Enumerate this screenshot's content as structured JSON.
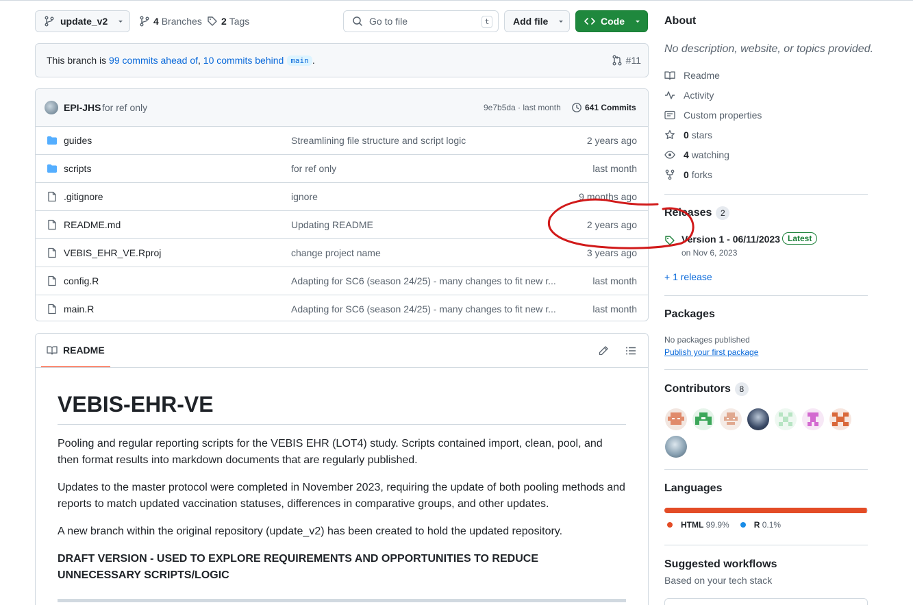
{
  "toolbar": {
    "branch_name": "update_v2",
    "branches_count": "4",
    "branches_label": "Branches",
    "tags_count": "2",
    "tags_label": "Tags",
    "goto_placeholder": "Go to file",
    "goto_shortcut": "t",
    "add_file_label": "Add file",
    "code_label": "Code"
  },
  "branch_banner": {
    "prefix": "This branch is ",
    "ahead": "99 commits ahead of",
    "separator": ", ",
    "behind": "10 commits behind",
    "base_branch": "main",
    "suffix": ".",
    "pr_number": "#11"
  },
  "latest_commit": {
    "author": "EPI-JHS",
    "message": "for ref only",
    "sha": "9e7b5da",
    "time": " · last month",
    "commits_count": "641 Commits"
  },
  "files": [
    {
      "type": "folder",
      "name": "guides",
      "message": "Streamlining file structure and script logic",
      "age": "2 years ago"
    },
    {
      "type": "folder",
      "name": "scripts",
      "message": "for ref only",
      "age": "last month"
    },
    {
      "type": "file",
      "name": ".gitignore",
      "message": "ignore",
      "age": "9 months ago"
    },
    {
      "type": "file",
      "name": "README.md",
      "message": "Updating README",
      "age": "2 years ago"
    },
    {
      "type": "file",
      "name": "VEBIS_EHR_VE.Rproj",
      "message": "change project name",
      "age": "3 years ago"
    },
    {
      "type": "file",
      "name": "config.R",
      "message": "Adapting for SC6 (season 24/25) - many changes to fit new r...",
      "age": "last month"
    },
    {
      "type": "file",
      "name": "main.R",
      "message": "Adapting for SC6 (season 24/25) - many changes to fit new r...",
      "age": "last month"
    }
  ],
  "readme": {
    "tab_label": "README",
    "title": "VEBIS-EHR-VE",
    "paragraphs": [
      "Pooling and regular reporting scripts for the VEBIS EHR (LOT4) study. Scripts contained import, clean, pool, and then format results into markdown documents that are regularly published.",
      "Updates to the master protocol were completed in November 2023, requiring the update of both pooling methods and reports to match updated vaccination statuses, differences in comparative groups, and other updates.",
      "A new branch within the original repository (update_v2) has been created to hold the updated repository."
    ],
    "draft_note": "DRAFT VERSION - USED TO EXPLORE REQUIREMENTS AND OPPORTUNITIES TO REDUCE UNNECESSARY SCRIPTS/LOGIC"
  },
  "about": {
    "heading": "About",
    "description": "No description, website, or topics provided.",
    "readme": "Readme",
    "activity": "Activity",
    "custom_properties": "Custom properties",
    "stars_count": "0",
    "stars_label": "stars",
    "watching_count": "4",
    "watching_label": "watching",
    "forks_count": "0",
    "forks_label": "forks"
  },
  "releases": {
    "heading": "Releases",
    "count": "2",
    "latest_name": "Version 1 - 06/11/2023",
    "latest_badge": "Latest",
    "latest_date": "on Nov 6, 2023",
    "more_link": "+ 1 release"
  },
  "packages": {
    "heading": "Packages",
    "none_text": "No packages published",
    "publish_link": "Publish your first package"
  },
  "contributors": {
    "heading": "Contributors",
    "count": "8"
  },
  "languages": {
    "heading": "Languages",
    "items": [
      {
        "name": "HTML",
        "percent": "99.9%",
        "fraction": 0.999,
        "color": "#e34c26"
      },
      {
        "name": "R",
        "percent": "0.1%",
        "fraction": 0.001,
        "color": "#198ce7"
      }
    ]
  },
  "workflows": {
    "heading": "Suggested workflows",
    "subtitle": "Based on your tech stack"
  },
  "annotation": {
    "color": "#d11a1a"
  }
}
